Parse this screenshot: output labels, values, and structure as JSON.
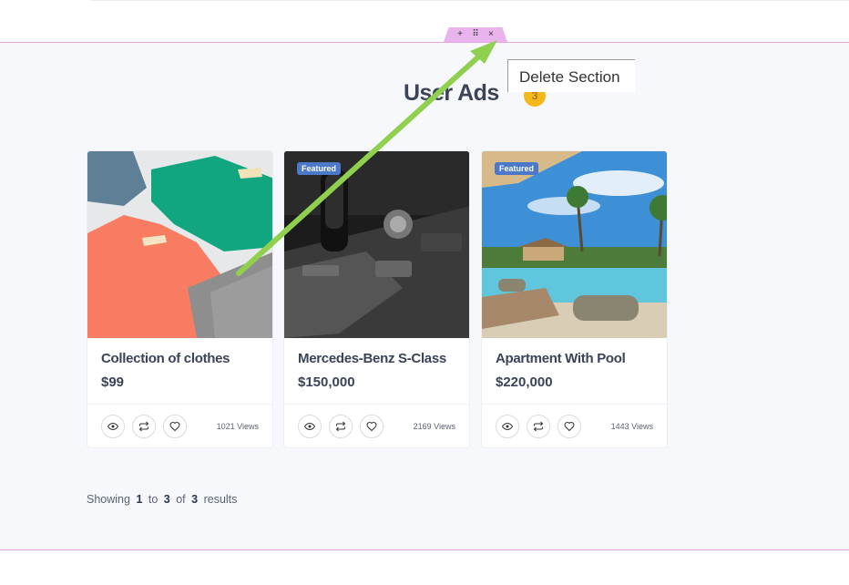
{
  "section_toolbar": {
    "add_icon": "+",
    "drag_icon": "⠿",
    "close_icon": "×"
  },
  "tooltip": {
    "text": "Delete Section"
  },
  "header": {
    "title": "User Ads",
    "count": "3"
  },
  "cards": [
    {
      "title": "Collection of clothes",
      "price": "$99",
      "views": "1021 Views",
      "featured": ""
    },
    {
      "title": "Mercedes-Benz S-Class",
      "price": "$150,000",
      "views": "2169 Views",
      "featured": "Featured"
    },
    {
      "title": "Apartment With Pool",
      "price": "$220,000",
      "views": "1443 Views",
      "featured": "Featured"
    }
  ],
  "pagination": {
    "showing": "Showing",
    "from": "1",
    "to_word": "to",
    "to": "3",
    "of_word": "of",
    "total": "3",
    "results": "results"
  },
  "colors": {
    "accent_pink": "#e6a3e6",
    "badge": "#f5b819",
    "featured": "#4b78c9",
    "arrow": "#8fd14f"
  },
  "icons": [
    "plus-icon",
    "drag-handle-icon",
    "close-icon",
    "eye-icon",
    "compare-icon",
    "heart-icon"
  ]
}
